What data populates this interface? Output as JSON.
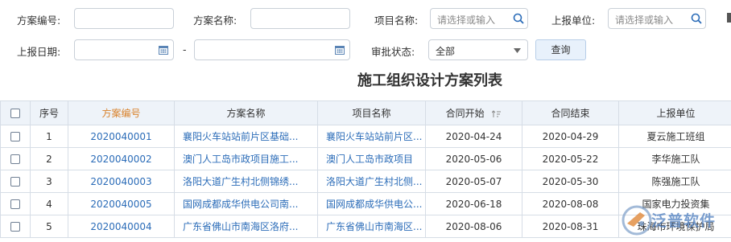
{
  "filters": {
    "plan_no_label": "方案编号:",
    "plan_name_label": "方案名称:",
    "project_name_label": "项目名称:",
    "project_name_placeholder": "请选择或输入",
    "report_unit_label": "上报单位:",
    "report_unit_placeholder": "请选择或输入",
    "report_date_label": "上报日期:",
    "date_separator": "-",
    "approval_label": "审批状态:",
    "approval_value": "全部",
    "query_button": "查询"
  },
  "title": "施工组织设计方案列表",
  "table": {
    "headers": {
      "seq": "序号",
      "plan_no": "方案编号",
      "plan_name": "方案名称",
      "project": "项目名称",
      "start": "合同开始",
      "end": "合同结束",
      "unit": "上报单位"
    },
    "rows": [
      {
        "seq": "1",
        "plan_no": "2020040001",
        "plan_name": "襄阳火车站站前片区基础...",
        "project": "襄阳火车站站前片区...",
        "start": "2020-04-24",
        "end": "2020-04-29",
        "unit": "夏云施工班组"
      },
      {
        "seq": "2",
        "plan_no": "2020040002",
        "plan_name": "澳门人工岛市政项目施工...",
        "project": "澳门人工岛市政项目",
        "start": "2020-05-06",
        "end": "2020-05-22",
        "unit": "李华施工队"
      },
      {
        "seq": "3",
        "plan_no": "2020040003",
        "plan_name": "洛阳大道广生村北侧锦绣...",
        "project": "洛阳大道广生村北侧...",
        "start": "2020-05-07",
        "end": "2020-05-30",
        "unit": "陈强施工队"
      },
      {
        "seq": "4",
        "plan_no": "2020040005",
        "plan_name": "国网成都成华供电公司南...",
        "project": "国网成都成华供电公...",
        "start": "2020-06-18",
        "end": "2020-08-08",
        "unit": "国家电力投资集"
      },
      {
        "seq": "5",
        "plan_no": "2020040004",
        "plan_name": "广东省佛山市南海区洛府...",
        "project": "广东省佛山市南海区...",
        "start": "2020-08-06",
        "end": "2020-08-31",
        "unit": "珠海市环境保护局"
      }
    ]
  },
  "watermark": "泛普软件"
}
